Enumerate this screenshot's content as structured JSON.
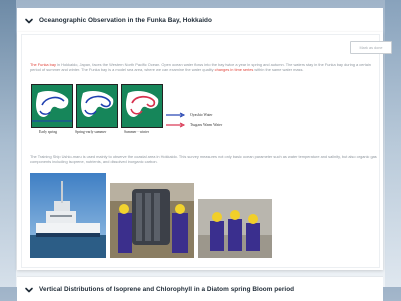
{
  "section1": {
    "title": "Oceanographic Observation in the Funka Bay, Hokkaido",
    "mark_button": "Mark as done",
    "para1_red_lead": "The Funka bay",
    "para1_text": " in Hokkaido, Japan, faces the Western North Pacific Ocean. Open ocean water flows into the bay twice a year in spring and autumn. The waters stay in the Funka bay during a certain period of summer and winter. The Funka bay is a model sea area, where we can examine the water quality ",
    "para1_red_mid": "changes in time series",
    "para1_tail": " within the same water mass.",
    "map_captions": [
      "Early spring",
      "Spring-early summer",
      "Summer - winter"
    ],
    "legend": [
      {
        "label": "Oyashio Water",
        "color": "#1f3fb0"
      },
      {
        "label": "Tsugaru Warm Water",
        "color": "#d8324f"
      }
    ],
    "para2": "The Training Ship Ushio-maru is used mainly to observe the coastal area in Hokkaido. This survey measures not only basic ocean parameter such as water temperature and salinity, but also organic gas components including isoprene, nutrients, and dissolved inorganic carbon.",
    "photos": [
      "ship-photo",
      "sampling-bottles-photo",
      "crew-on-deck-photo"
    ]
  },
  "section2": {
    "title": "Vertical Distributions of Isoprene and Chlorophyll in a Diatom spring Bloom period"
  },
  "colors": {
    "accent_red": "#e0443b",
    "map_land": "#16865a",
    "oyashio": "#1f3fb0",
    "tsugaru": "#d8324f"
  }
}
